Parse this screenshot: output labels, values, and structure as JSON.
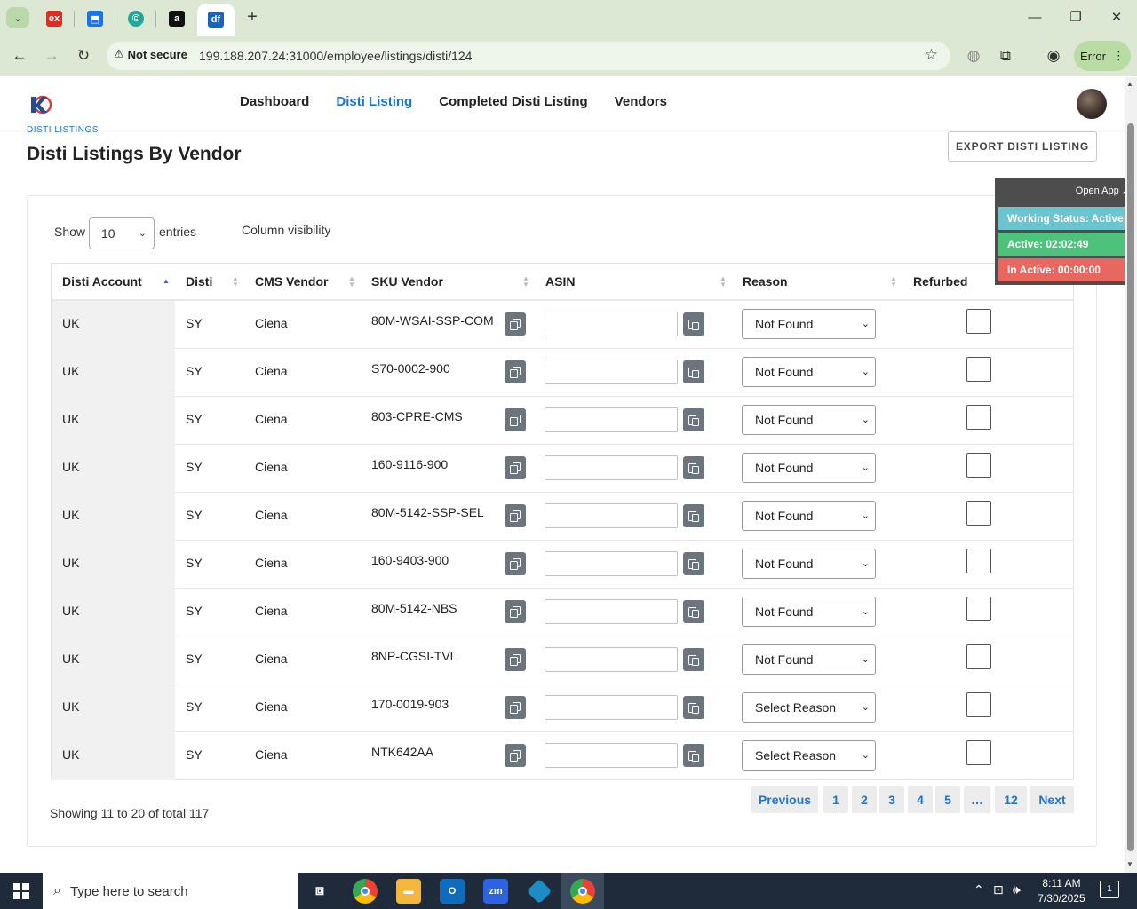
{
  "browser": {
    "tabs": [
      {
        "icon": "ex-icon",
        "label": "ex",
        "color": "#d93025"
      },
      {
        "icon": "puzzle-blue-icon",
        "label": "",
        "color": "#1a73e8"
      },
      {
        "icon": "c-circle-icon",
        "label": "©",
        "color": "#26a69a"
      },
      {
        "icon": "amazon-icon",
        "label": "a",
        "color": "#111111"
      },
      {
        "icon": "df-icon",
        "label": "df",
        "color": "#1565c0"
      }
    ],
    "security_label": "Not secure",
    "url": "199.188.207.24:31000/employee/listings/disti/124",
    "error_label": "Error"
  },
  "nav": {
    "items": [
      "Dashboard",
      "Disti Listing",
      "Completed Disti Listing",
      "Vendors"
    ],
    "active_index": 1
  },
  "page": {
    "breadcrumb": "DISTI LISTINGS",
    "title": "Disti Listings By Vendor",
    "export_label": "EXPORT DISTI LISTING"
  },
  "table_controls": {
    "show_label": "Show",
    "entries_value": "10",
    "entries_label": "entries",
    "column_visibility": "Column visibility"
  },
  "table": {
    "headers": [
      "Disti Account",
      "Disti",
      "CMS Vendor",
      "SKU Vendor",
      "ASIN",
      "Reason",
      "Refurbed"
    ],
    "rows": [
      {
        "account": "UK",
        "disti": "SY",
        "cms_vendor": "Ciena",
        "sku": "80M-WSAI-SSP-COM",
        "asin": "",
        "reason": "Not Found",
        "refurbed": false
      },
      {
        "account": "UK",
        "disti": "SY",
        "cms_vendor": "Ciena",
        "sku": "S70-0002-900",
        "asin": "",
        "reason": "Not Found",
        "refurbed": false
      },
      {
        "account": "UK",
        "disti": "SY",
        "cms_vendor": "Ciena",
        "sku": "803-CPRE-CMS",
        "asin": "",
        "reason": "Not Found",
        "refurbed": false
      },
      {
        "account": "UK",
        "disti": "SY",
        "cms_vendor": "Ciena",
        "sku": "160-9116-900",
        "asin": "",
        "reason": "Not Found",
        "refurbed": false
      },
      {
        "account": "UK",
        "disti": "SY",
        "cms_vendor": "Ciena",
        "sku": "80M-5142-SSP-SEL",
        "asin": "",
        "reason": "Not Found",
        "refurbed": false
      },
      {
        "account": "UK",
        "disti": "SY",
        "cms_vendor": "Ciena",
        "sku": "160-9403-900",
        "asin": "",
        "reason": "Not Found",
        "refurbed": false
      },
      {
        "account": "UK",
        "disti": "SY",
        "cms_vendor": "Ciena",
        "sku": "80M-5142-NBS",
        "asin": "",
        "reason": "Not Found",
        "refurbed": false
      },
      {
        "account": "UK",
        "disti": "SY",
        "cms_vendor": "Ciena",
        "sku": "8NP-CGSI-TVL",
        "asin": "",
        "reason": "Not Found",
        "refurbed": false
      },
      {
        "account": "UK",
        "disti": "SY",
        "cms_vendor": "Ciena",
        "sku": "170-0019-903",
        "asin": "",
        "reason": "Select Reason",
        "refurbed": false
      },
      {
        "account": "UK",
        "disti": "SY",
        "cms_vendor": "Ciena",
        "sku": "NTK642AA",
        "asin": "",
        "reason": "Select Reason",
        "refurbed": false
      }
    ]
  },
  "pagination": {
    "info": "Showing 11 to 20 of total 117",
    "previous": "Previous",
    "pages": [
      "1",
      "2",
      "3",
      "4",
      "5",
      "…",
      "12"
    ],
    "next": "Next"
  },
  "status_widget": {
    "open_app": "Open App ↗",
    "working_status": "Working Status: Active",
    "active_time": "Active: 02:02:49",
    "inactive_time": "In Active: 00:00:00",
    "colors": {
      "working": "#6cc4cf",
      "active": "#4cc27a",
      "inactive": "#e8675e"
    }
  },
  "taskbar": {
    "search_placeholder": "Type here to search",
    "time": "8:11 AM",
    "date": "7/30/2025",
    "notification_count": "1"
  },
  "colors": {
    "accent": "#1976d2",
    "browser_chrome": "#dce8d3"
  }
}
